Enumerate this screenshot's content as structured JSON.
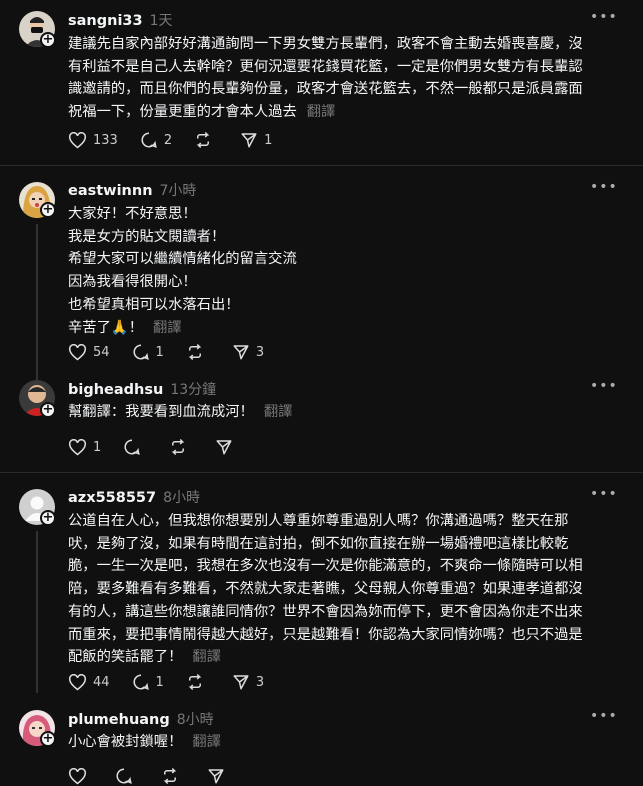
{
  "translate_label": "翻譯",
  "posts": [
    {
      "username": "sangni33",
      "time": "1天",
      "lines": [
        "建議先自家內部好好溝通詢問一下男女雙方長輩們，政客不會主動去婚喪喜慶，沒",
        "有利益不是自己人去幹啥？更何況還要花錢買花籃，一定是你們男女雙方有長輩認",
        "識邀請的，而且你們的長輩夠份量，政客才會送花籃去，不然一般都只是派員露面",
        "祝福一下，份量更重的才會本人過去"
      ],
      "likes": "133",
      "replies": "2",
      "reposts": "",
      "shares": "1"
    },
    {
      "username": "eastwinnn",
      "time": "7小時",
      "lines": [
        "大家好！不好意思！",
        "我是女方的貼文閱讀者！",
        "希望大家可以繼續情緒化的留言交流",
        "因為我看得很開心！",
        "也希望真相可以水落石出！",
        "辛苦了🙏！"
      ],
      "likes": "54",
      "replies": "1",
      "reposts": "",
      "shares": "3"
    },
    {
      "username": "bigheadhsu",
      "time": "13分鐘",
      "lines": [
        "幫翻譯：我要看到血流成河！"
      ],
      "likes": "1",
      "replies": "",
      "reposts": "",
      "shares": ""
    },
    {
      "username": "azx558557",
      "time": "8小時",
      "lines": [
        "公道自在人心，但我想你想要別人尊重妳尊重過別人嗎？你溝通過嗎？整天在那",
        "吠，是夠了沒，如果有時間在這討拍，倒不如你直接在辦一場婚禮吧這樣比較乾",
        "脆，一生一次是吧，我想在多次也沒有一次是你能滿意的，不爽命一條隨時可以相",
        "陪，要多難看有多難看，不然就大家走著瞧，父母親人你尊重過？如果連孝道都沒",
        "有的人，講這些你想讓誰同情你？世界不會因為妳而停下，更不會因為你走不出來",
        "而重來，要把事情鬧得越大越好，只是越難看！你認為大家同情妳嗎？也只不過是",
        "配飯的笑話罷了！"
      ],
      "likes": "44",
      "replies": "1",
      "reposts": "",
      "shares": "3"
    },
    {
      "username": "plumehuang",
      "time": "8小時",
      "lines": [
        "小心會被封鎖喔！"
      ],
      "likes": "",
      "replies": "",
      "reposts": "",
      "shares": ""
    }
  ]
}
